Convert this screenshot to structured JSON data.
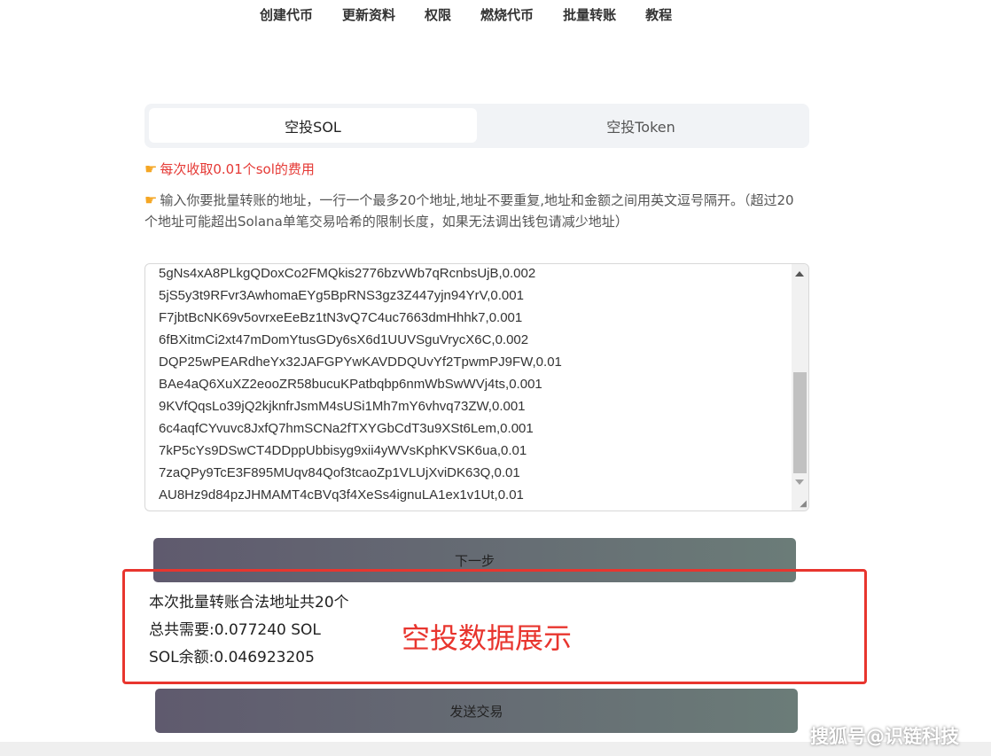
{
  "nav": {
    "items": [
      "创建代币",
      "更新资料",
      "权限",
      "燃烧代币",
      "批量转账",
      "教程"
    ]
  },
  "tabs": {
    "active": "空投SOL",
    "inactive": "空投Token"
  },
  "notice": {
    "icon": "pointing-hand-icon",
    "text": "每次收取0.01个sol的费用"
  },
  "instruction": {
    "icon": "pointing-hand-icon",
    "text": "输入你要批量转账的地址，一行一个最多20个地址,地址不要重复,地址和金额之间用英文逗号隔开。（超过20个地址可能超出Solana单笔交易哈希的限制长度，如果无法调出钱包请减少地址）"
  },
  "addresses": [
    "5gNs4xA8PLkgQDoxCo2FMQkis2776bzvWb7qRcnbsUjB,0.002",
    "5jS5y3t9RFvr3AwhomaEYg5BpRNS3gz3Z447yjn94YrV,0.001",
    "F7jbtBcNK69v5ovrxeEeBz1tN3vQ7C4uc7663dmHhhk7,0.001",
    "6fBXitmCi2xt47mDomYtusGDy6sX6d1UUVSguVrycX6C,0.002",
    "DQP25wPEARdheYx32JAFGPYwKAVDDQUvYf2TpwmPJ9FW,0.01",
    "BAe4aQ6XuXZ2eooZR58bucuKPatbqbp6nmWbSwWVj4ts,0.001",
    "9KVfQqsLo39jQ2kjknfrJsmM4sUSi1Mh7mY6vhvq73ZW,0.001",
    "6c4aqfCYvuvc8JxfQ7hmSCNa2fTXYGbCdT3u9XSt6Lem,0.001",
    "7kP5cYs9DSwCT4DDppUbbisyg9xii4yWVsKphKVSK6ua,0.01",
    "7zaQPy9TcE3F895MUqv84Qof3tcaoZp1VLUjXviDK63Q,0.01",
    "AU8Hz9d84pzJHMAMT4cBVq3f4XeSs4ignuLA1ex1v1Ut,0.01"
  ],
  "buttons": {
    "next": "下一步",
    "send": "发送交易"
  },
  "summary": {
    "count": "本次批量转账合法地址共20个",
    "total": "总共需要:0.077240 SOL",
    "balance": "SOL余额:0.046923205"
  },
  "annotation": "空投数据展示",
  "watermark": "搜狐号@识链科技",
  "colors": {
    "notice_red": "#e53935",
    "annotation_red": "#e8352e",
    "button_gradient_start": "#5f5a6e",
    "button_gradient_end": "#6b7c78"
  }
}
